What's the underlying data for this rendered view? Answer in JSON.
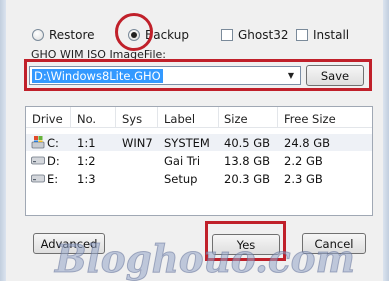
{
  "options": [
    {
      "label": "Restore",
      "kind": "radio",
      "selected": false
    },
    {
      "label": "Backup",
      "kind": "radio",
      "selected": true
    },
    {
      "label": "Ghost32",
      "kind": "checkbox",
      "checked": false
    },
    {
      "label": "Install",
      "kind": "checkbox",
      "checked": false
    }
  ],
  "image_file": {
    "label": "GHO WIM ISO ImageFile:",
    "value": "D:\\Windows8Lite.GHO",
    "save_label": "Save"
  },
  "table": {
    "columns": [
      "Drive",
      "No.",
      "Sys",
      "Label",
      "Size",
      "Free Size"
    ],
    "rows": [
      {
        "drive": "C:",
        "no": "1:1",
        "sys": "WIN7",
        "label": "SYSTEM",
        "size": "40.5 GB",
        "free": "24.8 GB",
        "icon": "system-drive-icon"
      },
      {
        "drive": "D:",
        "no": "1:2",
        "sys": "",
        "label": "Gai Tri",
        "size": "13.8 GB",
        "free": "2.2 GB",
        "icon": "hard-drive-icon"
      },
      {
        "drive": "E:",
        "no": "1:3",
        "sys": "",
        "label": "Setup",
        "size": "20.3 GB",
        "free": "2.3 GB",
        "icon": "hard-drive-icon"
      }
    ]
  },
  "buttons": {
    "advanced": "Advanced",
    "yes": "Yes",
    "cancel": "Cancel"
  },
  "watermark": "Bloghouo.com",
  "colors": {
    "highlight": "#c0202a",
    "selection": "#3399ff"
  }
}
